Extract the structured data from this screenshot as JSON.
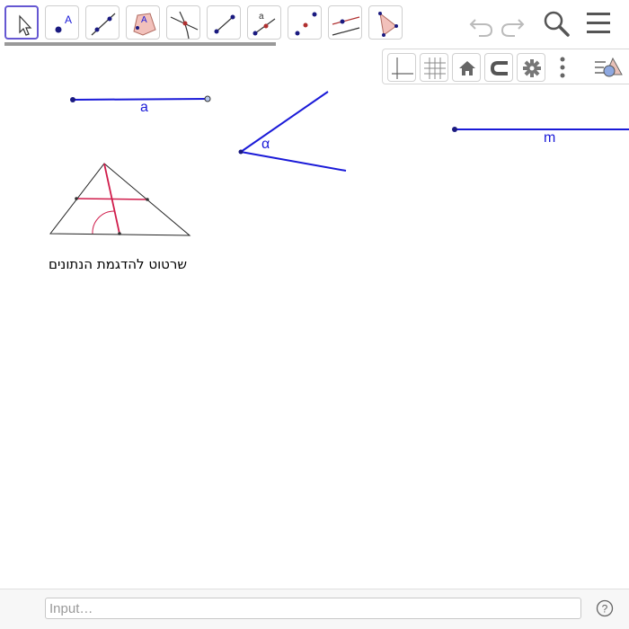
{
  "toolbar": {
    "tools": [
      {
        "name": "move-tool",
        "active": true
      },
      {
        "name": "point-tool",
        "glyph": "A"
      },
      {
        "name": "line-tool"
      },
      {
        "name": "polygon-tool",
        "glyph": "A"
      },
      {
        "name": "perpendicular-line-tool"
      },
      {
        "name": "segment-tool"
      },
      {
        "name": "segment-fixed-length-tool",
        "glyph": "a"
      },
      {
        "name": "midpoint-tool"
      },
      {
        "name": "parallel-line-tool"
      },
      {
        "name": "triangle-tool"
      }
    ],
    "undo_icon": "undo-icon",
    "redo_icon": "redo-icon",
    "search_icon": "search-icon",
    "menu_icon": "hamburger-menu-icon"
  },
  "graphics_panel": {
    "buttons": [
      "axes-toggle-icon",
      "grid-toggle-icon",
      "home-icon",
      "magnet-snap-icon",
      "gear-icon",
      "more-vertical-icon",
      "style-bar-icon"
    ]
  },
  "canvas": {
    "segment_a_label": "a",
    "angle_label": "α",
    "segment_m_label": "m",
    "caption": "שרטוט להדגמת הנתונים"
  },
  "input_bar": {
    "placeholder": "Input…",
    "help_icon": "help-icon"
  },
  "colors": {
    "object_blue": "#1a1ad8",
    "accent_red": "#d01c4b",
    "tool_active_border": "#6557d2"
  }
}
